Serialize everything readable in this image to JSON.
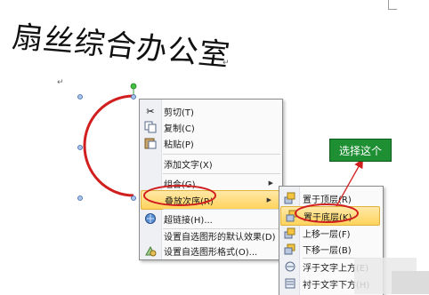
{
  "document": {
    "title_text": "扇丝综合办公室",
    "paragraph_mark": "↵"
  },
  "context_menu": {
    "items": [
      {
        "icon": "scissors-icon",
        "label": "剪切(T)"
      },
      {
        "icon": "copy-icon",
        "label": "复制(C)"
      },
      {
        "icon": "paste-icon",
        "label": "粘贴(P)"
      },
      {
        "icon": "",
        "label": "添加文字(X)"
      },
      {
        "icon": "",
        "label": "组合(G)"
      },
      {
        "icon": "",
        "label": "叠放次序(R)"
      },
      {
        "icon": "hyperlink-icon",
        "label": "超链接(H)..."
      },
      {
        "icon": "",
        "label": "设置自选图形的默认效果(D)"
      },
      {
        "icon": "format-shape-icon",
        "label": "设置自选图形格式(O)..."
      }
    ]
  },
  "order_submenu": {
    "items": [
      {
        "icon": "bring-to-front-icon",
        "label": "置于顶层(R)"
      },
      {
        "icon": "send-to-back-icon",
        "label": "置于底层(K)"
      },
      {
        "icon": "bring-forward-icon",
        "label": "上移一层(F)"
      },
      {
        "icon": "send-backward-icon",
        "label": "下移一层(B)"
      },
      {
        "icon": "in-front-of-text-icon",
        "label": "浮于文字上方(E)"
      },
      {
        "icon": "behind-text-icon",
        "label": "衬于文字下方(H)"
      }
    ]
  },
  "callout": {
    "text": "选择这个"
  },
  "colors": {
    "annotation_red": "#d11f1f",
    "callout_green": "#1e8f32",
    "highlight": "#ffd35c"
  }
}
